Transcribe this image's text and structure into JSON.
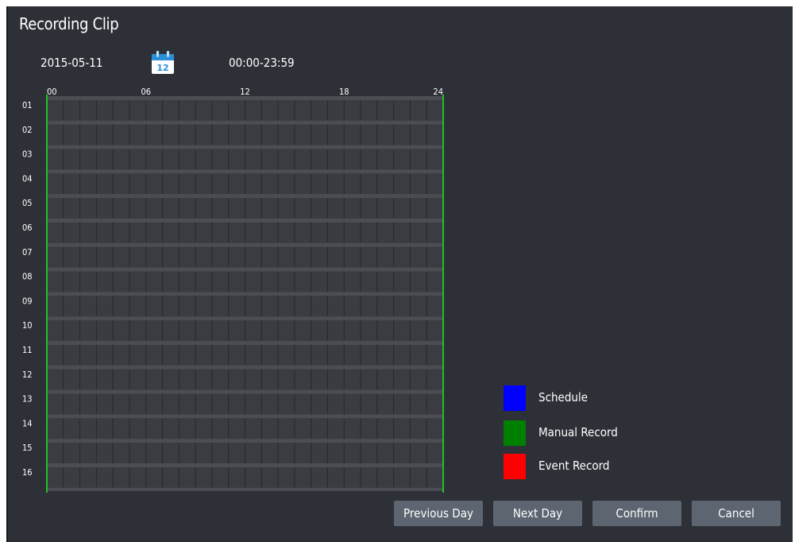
{
  "title": "Recording Clip",
  "date": "2015-05-11",
  "calendar_icon": {
    "name": "calendar-icon",
    "day": "12",
    "color": "#2a8fd8"
  },
  "time_range": "00:00-23:59",
  "timeline": {
    "hour_labels": [
      "00",
      "06",
      "12",
      "18",
      "24"
    ],
    "channels": [
      "01",
      "02",
      "03",
      "04",
      "05",
      "06",
      "07",
      "08",
      "09",
      "10",
      "11",
      "12",
      "13",
      "14",
      "15",
      "16"
    ],
    "hours": 24,
    "recordings": []
  },
  "legend": [
    {
      "label": "Schedule",
      "color": "#0000ff"
    },
    {
      "label": "Manual Record",
      "color": "#008000"
    },
    {
      "label": "Event Record",
      "color": "#ff0000"
    }
  ],
  "buttons": {
    "previous_day": "Previous Day",
    "next_day": "Next Day",
    "confirm": "Confirm",
    "cancel": "Cancel"
  }
}
